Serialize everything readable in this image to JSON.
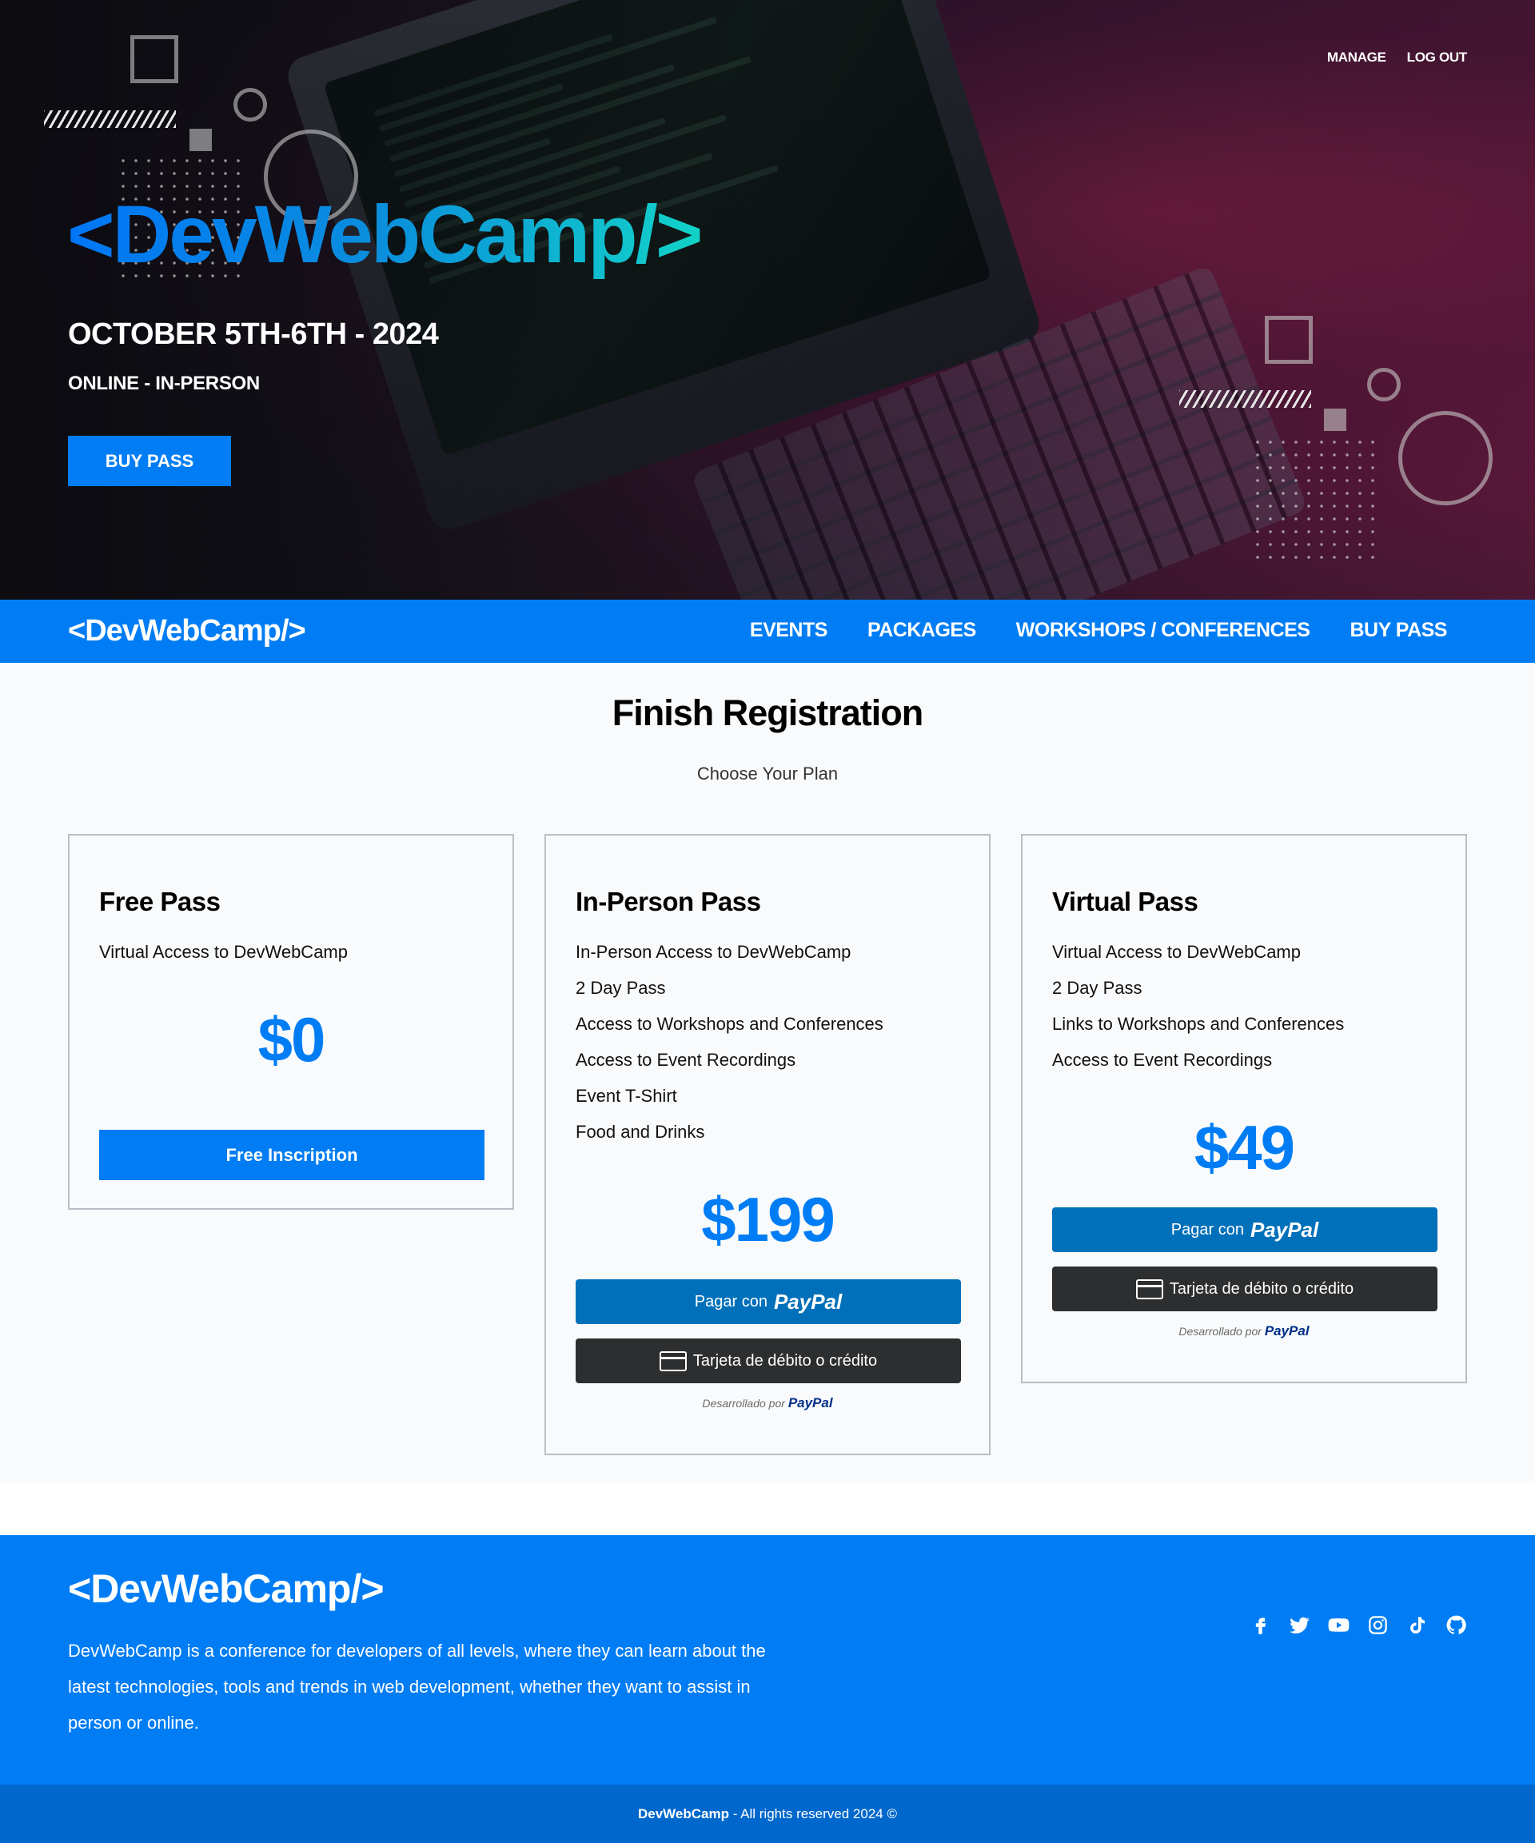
{
  "hero": {
    "top_links": {
      "manage": "MANAGE",
      "logout": "LOG OUT"
    },
    "logo": "<DevWebCamp/>",
    "date": "OCTOBER 5TH-6TH - 2024",
    "mode": "ONLINE - IN-PERSON",
    "buy_button": "BUY PASS"
  },
  "navbar": {
    "logo": "<DevWebCamp/>",
    "links": [
      "EVENTS",
      "PACKAGES",
      "WORKSHOPS / CONFERENCES",
      "BUY PASS"
    ]
  },
  "main": {
    "title": "Finish Registration",
    "subtitle": "Choose Your Plan",
    "plans": [
      {
        "name": "Free Pass",
        "features": [
          "Virtual Access to DevWebCamp"
        ],
        "price": "$0",
        "button": "Free Inscription"
      },
      {
        "name": "In-Person Pass",
        "features": [
          "In-Person Access to DevWebCamp",
          "2 Day Pass",
          "Access to Workshops and Conferences",
          "Access to Event Recordings",
          "Event T-Shirt",
          "Food and Drinks"
        ],
        "price": "$199",
        "paypal_prefix": "Pagar con",
        "paypal_brand": "PayPal",
        "card_button": "Tarjeta de débito o crédito",
        "powered_prefix": "Desarrollado por",
        "powered_brand": "PayPal"
      },
      {
        "name": "Virtual Pass",
        "features": [
          "Virtual Access to DevWebCamp",
          "2 Day Pass",
          "Links to Workshops and Conferences",
          "Access to Event Recordings"
        ],
        "price": "$49",
        "paypal_prefix": "Pagar con",
        "paypal_brand": "PayPal",
        "card_button": "Tarjeta de débito o crédito",
        "powered_prefix": "Desarrollado por",
        "powered_brand": "PayPal"
      }
    ]
  },
  "footer": {
    "logo": "<DevWebCamp/>",
    "description": "DevWebCamp is a conference for developers of all levels, where they can learn about the latest technologies, tools and trends in web development, whether they want to assist in person or online.",
    "socials": [
      "facebook-icon",
      "twitter-icon",
      "youtube-icon",
      "instagram-icon",
      "tiktok-icon",
      "github-icon"
    ],
    "copyright_brand": "DevWebCamp",
    "copyright_text": " - All rights reserved 2024 ©"
  },
  "colors": {
    "brand_blue": "#007df4",
    "paypal_blue": "#0070ba",
    "card_dark": "#2c2e2f",
    "copyright_blue": "#0067cc"
  }
}
